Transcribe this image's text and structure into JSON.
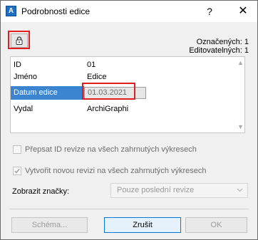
{
  "window": {
    "title": "Podrobnosti edice",
    "help": "?",
    "close": "✕",
    "icon": "app-icon"
  },
  "header": {
    "counts": "Označených: 1 Editovatelných: 1",
    "lock_icon": "lock-icon"
  },
  "table": {
    "rows": [
      {
        "key": "ID",
        "value": "01"
      },
      {
        "key": "Jméno",
        "value": "Edice"
      },
      {
        "key": "Datum edice",
        "value": "01.03.2021"
      },
      {
        "key": "Vydal",
        "value": "ArchiGraphi"
      }
    ]
  },
  "options": {
    "overwrite_id": {
      "label": "Přepsat ID revize na všech zahrnutých výkresech",
      "checked": false
    },
    "create_revision": {
      "label": "Vytvořit novou revizi na všech zahrnutých výkresech",
      "checked": true
    },
    "show_marks_label": "Zobrazit značky:",
    "show_marks_value": "Pouze poslední revize"
  },
  "buttons": {
    "schema": "Schéma...",
    "cancel": "Zrušit",
    "ok": "OK"
  },
  "colors": {
    "selection": "#3b84d0",
    "highlight": "#e01e1e",
    "primary_border": "#0078d7"
  }
}
